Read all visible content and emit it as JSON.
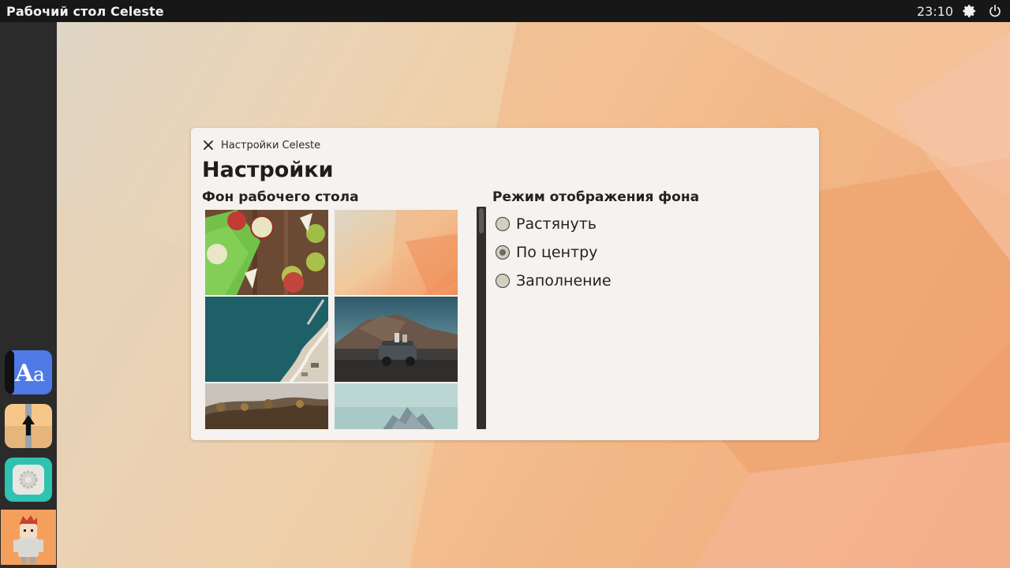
{
  "topbar": {
    "title": "Рабочий стол Celeste",
    "clock": "23:10",
    "icons": [
      "gear-icon",
      "power-icon"
    ]
  },
  "dock": {
    "items": [
      {
        "name": "fonts-app",
        "icon": "font-aa-icon",
        "glyph": "Aa"
      },
      {
        "name": "updater-app",
        "icon": "arrow-up-package-icon"
      },
      {
        "name": "settings-app",
        "icon": "gear-icon"
      },
      {
        "name": "user-avatar",
        "icon": "avatar-icon"
      }
    ]
  },
  "window": {
    "subtitle": "Настройки Celeste",
    "title": "Настройки",
    "background_section": {
      "title": "Фон рабочего стола",
      "thumbnails": [
        {
          "name": "apples",
          "icon": "apples-photo"
        },
        {
          "name": "gradient",
          "icon": "peach-gradient-photo"
        },
        {
          "name": "sea-coast",
          "icon": "sea-aerial-photo"
        },
        {
          "name": "jeep-mountains",
          "icon": "jeep-volcano-photo"
        },
        {
          "name": "autumn-hills",
          "icon": "forest-hills-photo"
        },
        {
          "name": "rocky-peaks",
          "icon": "mountain-peaks-photo"
        }
      ],
      "scroll_position": 0
    },
    "mode_section": {
      "title": "Режим отображения фона",
      "options": [
        {
          "label": "Растянуть",
          "checked": false
        },
        {
          "label": "По центру",
          "checked": true
        },
        {
          "label": "Заполнение",
          "checked": false
        }
      ]
    }
  },
  "colors": {
    "topbar": "#171717",
    "dock": "#2b2b2b",
    "window": "#f5f2ef",
    "wallpaper_accent": "#f1a273"
  }
}
